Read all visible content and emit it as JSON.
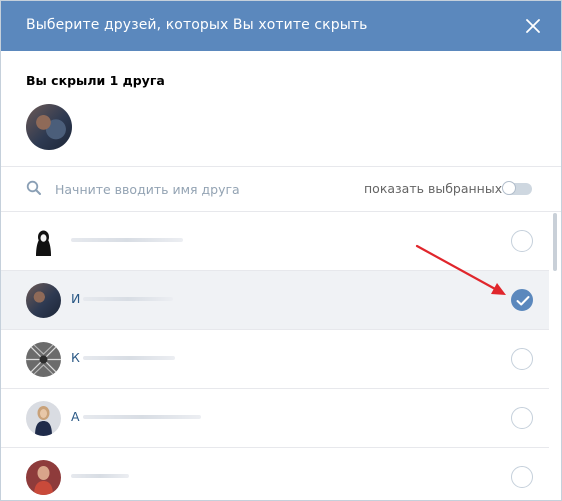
{
  "header": {
    "title": "Выберите друзей, которых Вы хотите скрыть",
    "close_icon": "close-icon"
  },
  "hidden_friends": {
    "label": "Вы скрыли 1 друга"
  },
  "search": {
    "placeholder": "Начните вводить имя друга",
    "value": "",
    "show_selected_label": "показать выбранных",
    "show_selected_on": false
  },
  "friends": [
    {
      "name": "",
      "selected": false
    },
    {
      "name": "И",
      "selected": true
    },
    {
      "name": "К",
      "selected": false
    },
    {
      "name": "А",
      "selected": false
    },
    {
      "name": "",
      "selected": false
    }
  ],
  "colors": {
    "header_bg": "#5b88bd",
    "accent": "#5b88bd",
    "annotation_arrow": "#e0262c"
  }
}
